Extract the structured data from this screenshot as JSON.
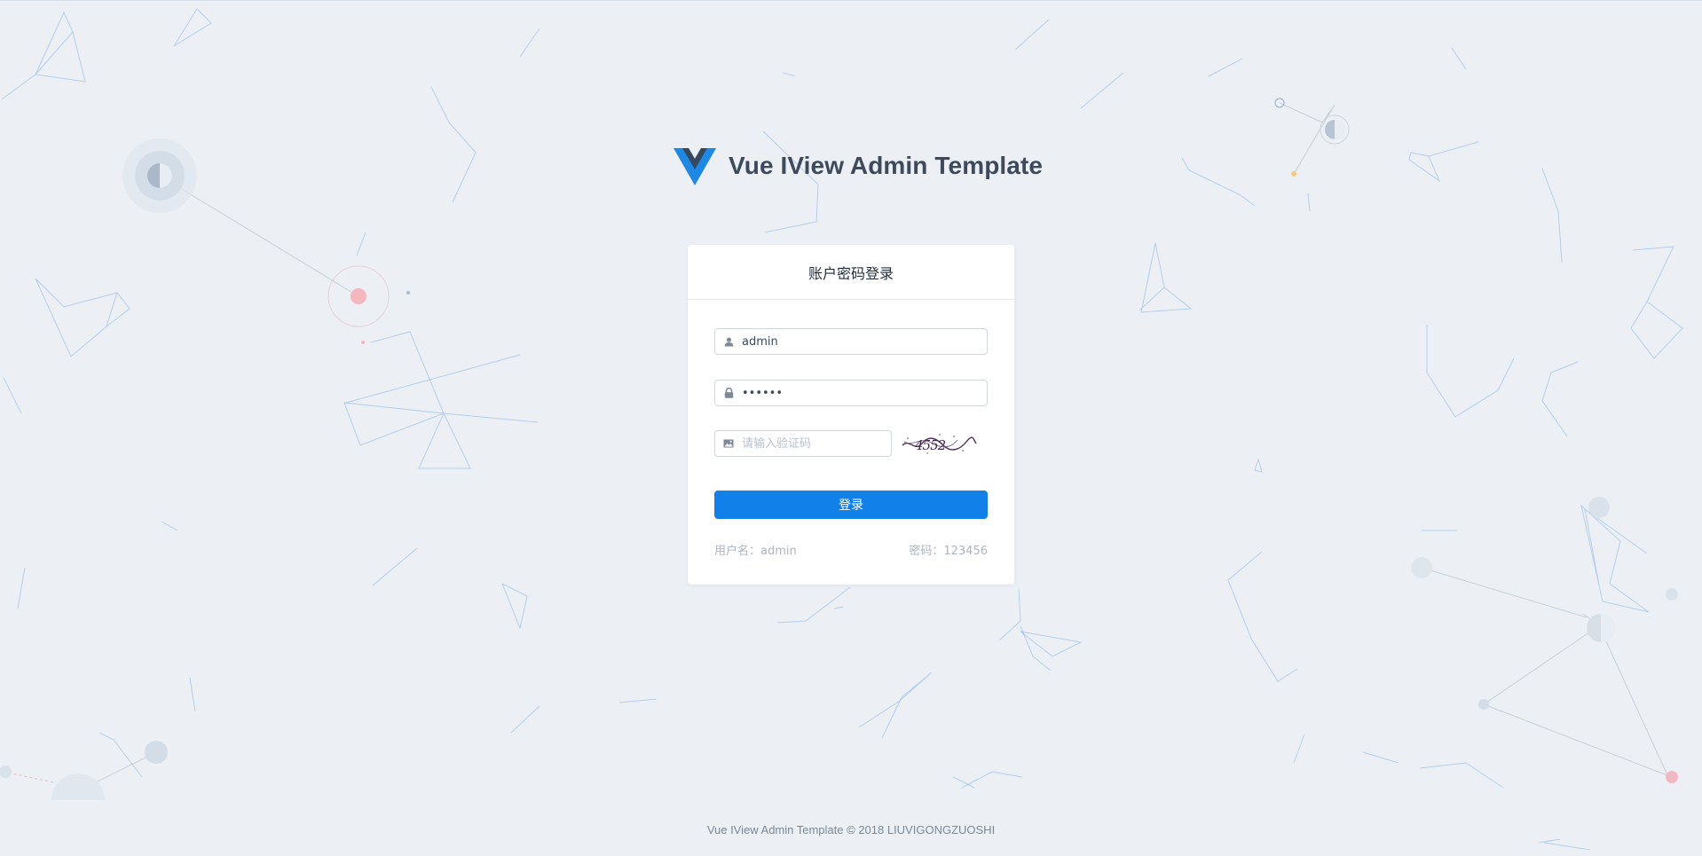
{
  "brand": {
    "title": "Vue IView Admin Template",
    "logo_icon": "vue-logo-icon",
    "colors": {
      "blue": "#1e88e5",
      "dark": "#34495e"
    }
  },
  "login": {
    "title": "账户密码登录",
    "username": {
      "value": "admin",
      "placeholder": "",
      "icon": "user-icon"
    },
    "password": {
      "value": "123456",
      "placeholder": "",
      "icon": "lock-icon"
    },
    "captcha": {
      "value": "",
      "placeholder": "请输入验证码",
      "icon": "image-icon",
      "image_text": "4552"
    },
    "submit_label": "登录",
    "hint_username": "用户名：admin",
    "hint_password": "密码：123456"
  },
  "footer": {
    "text": "Vue IView Admin Template © 2018 LIUVIGONGZUOSHI"
  },
  "colors": {
    "background": "#ecf0f4",
    "primary": "#1180e8",
    "card": "#ffffff"
  }
}
